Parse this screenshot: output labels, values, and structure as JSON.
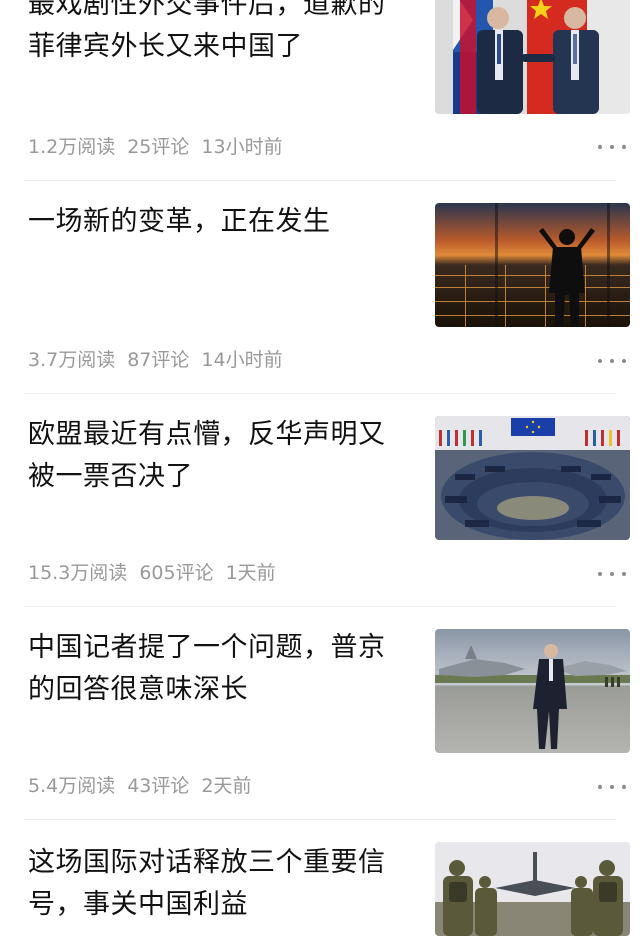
{
  "feed": {
    "items": [
      {
        "title": "最戏剧性外交事件后，道歉的菲律宾外长又来中国了",
        "reads": "1.2万阅读",
        "comments": "25评论",
        "time": "13小时前",
        "thumb_icon": "diplomats-photo"
      },
      {
        "title": "一场新的变革，正在发生",
        "reads": "3.7万阅读",
        "comments": "87评论",
        "time": "14小时前",
        "thumb_icon": "city-night-silhouette-photo"
      },
      {
        "title": "欧盟最近有点懵，反华声明又被一票否决了",
        "reads": "15.3万阅读",
        "comments": "605评论",
        "time": "1天前",
        "thumb_icon": "parliament-chamber-photo"
      },
      {
        "title": "中国记者提了一个问题，普京的回答很意味深长",
        "reads": "5.4万阅读",
        "comments": "43评论",
        "time": "2天前",
        "thumb_icon": "jet-runway-photo"
      },
      {
        "title": "这场国际对话释放三个重要信号，事关中国利益",
        "thumb_icon": "soldiers-aircraft-photo"
      }
    ]
  }
}
